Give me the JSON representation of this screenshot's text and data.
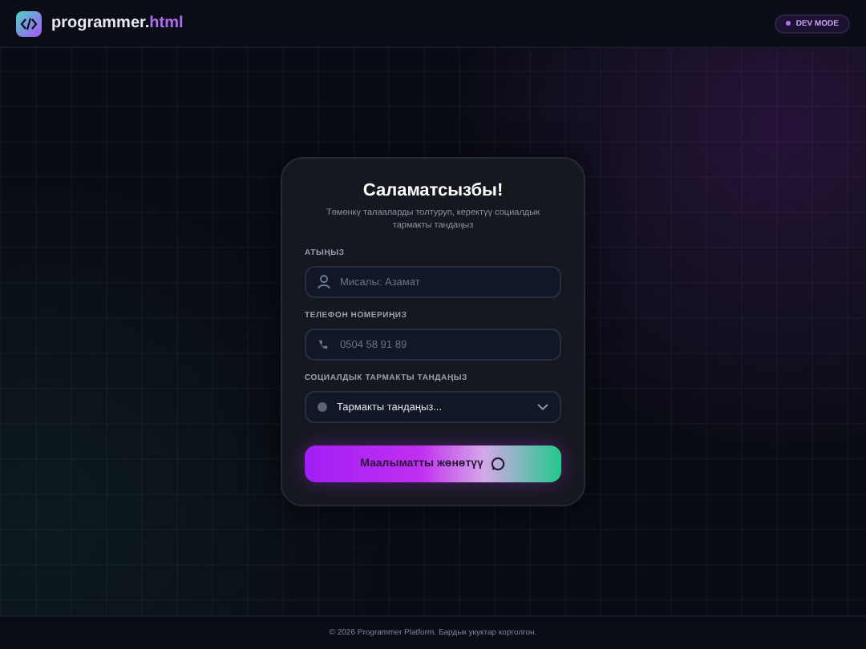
{
  "header": {
    "logo_text": "programmer.",
    "logo_accent": "html",
    "badge": "DEV MODE"
  },
  "card": {
    "title": "Саламатсызбы!",
    "subtitle": "Төмөнкү талааларды толтуруп, керектүү социалдык тармакты тандаңыз",
    "fields": [
      {
        "kind": "text",
        "label": "АТЫҢЫЗ",
        "placeholder": "Мисалы: Азамат"
      },
      {
        "kind": "phone",
        "label": "ТЕЛЕФОН НОМЕРИҢИЗ",
        "placeholder": "0504 58 91 89"
      },
      {
        "kind": "select",
        "label": "СОЦИАЛДЫК ТАРМАКТЫ ТАНДАҢЫЗ",
        "value": "Тармакты тандаңыз..."
      }
    ],
    "submit": "Маалыматты жөнөтүү"
  },
  "footer": "© 2026 Programmer Platform. Бардык укуктар корголгон."
}
